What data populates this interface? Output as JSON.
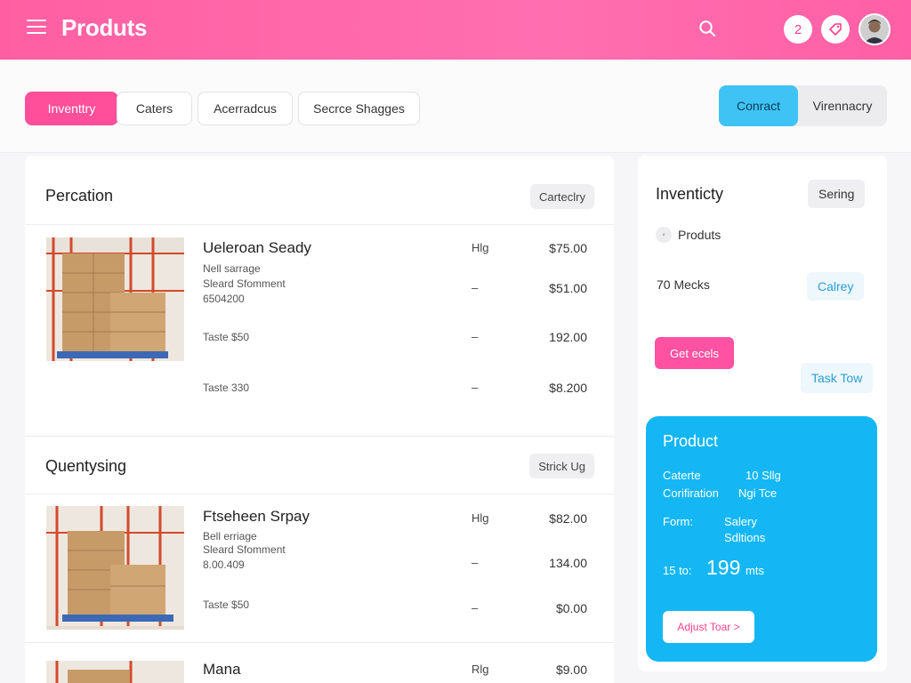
{
  "header": {
    "title": "Produts",
    "notif_count": "2",
    "icons": [
      "menu-icon",
      "search-icon",
      "tag-icon",
      "avatar"
    ]
  },
  "tabs": [
    {
      "label": "Inventtry",
      "active": true
    },
    {
      "label": "Caters",
      "active": false
    },
    {
      "label": "Acerradcus",
      "active": false
    },
    {
      "label": "Secrce Shagges",
      "active": false
    }
  ],
  "segment": {
    "on": "Conract",
    "off": "Virennacry"
  },
  "sections": [
    {
      "title": "Percation",
      "chip": "Carteclry",
      "product": {
        "name": "Ueleroan Seady",
        "lines": [
          "Nell sarrage",
          "Sleard Sfomment",
          "6504200"
        ],
        "rows": [
          {
            "label": "",
            "mid": "Hlg",
            "price": "$75.00"
          },
          {
            "label": "",
            "mid": "–",
            "price": "$51.00"
          },
          {
            "label": "Taste $50",
            "mid": "–",
            "price": "192.00"
          },
          {
            "label": "Taste 330",
            "mid": "–",
            "price": "$8.200"
          }
        ]
      }
    },
    {
      "title": "Quentysing",
      "chip": "Strick Ug",
      "product": {
        "name": "Ftseheen Srpay",
        "lines": [
          "Bell erriage",
          "Sleard Sfomment",
          "8.00.409"
        ],
        "rows": [
          {
            "label": "",
            "mid": "Hlg",
            "price": "$82.00"
          },
          {
            "label": "",
            "mid": "–",
            "price": "134.00"
          },
          {
            "label": "Taste $50",
            "mid": "–",
            "price": "$0.00"
          }
        ]
      }
    },
    {
      "title": "",
      "chip": "",
      "product": {
        "name": "Mana",
        "lines": [],
        "rows": [
          {
            "label": "",
            "mid": "Rlg",
            "price": "$9.00"
          }
        ]
      }
    }
  ],
  "right_panel": {
    "title": "Inventicty",
    "chip": "Sering",
    "products_label": "Produts",
    "mecks": "70 Mecks",
    "calrey": "Calrey",
    "get_btn": "Get ecels",
    "task_btn": "Task Tow"
  },
  "product_card": {
    "title": "Product",
    "c1": "Caterte",
    "c1v": "10 Sllg",
    "c2": "Corifiration",
    "c2v": "Ngi Tce",
    "form": "Form:",
    "form_v1": "Salery",
    "form_v2": "Sdltions",
    "small_prefix": "15 to:",
    "big": "199",
    "suffix": "mts",
    "adjust": "Adjust Toar >"
  },
  "colors": {
    "brand_pink": "#ff5fa2",
    "accent_blue": "#14b7f4"
  }
}
